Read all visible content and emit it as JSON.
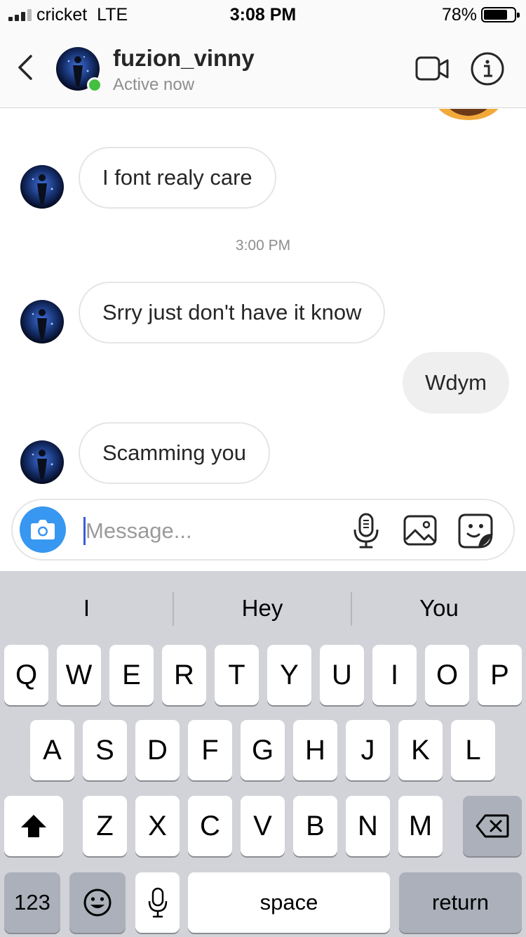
{
  "status_bar": {
    "carrier": "cricket",
    "network": "LTE",
    "time": "3:08 PM",
    "battery_pct": "78%",
    "battery_level": 0.78
  },
  "header": {
    "username": "fuzion_vinny",
    "status": "Active now",
    "icons": [
      "chevron-left-icon",
      "video-camera-icon",
      "info-icon"
    ]
  },
  "messages": [
    {
      "from": "them",
      "text": "I font realy care"
    },
    {
      "timestamp": "3:00 PM"
    },
    {
      "from": "them",
      "text": "Srry just don't have it know"
    },
    {
      "from": "me",
      "text": "Wdym"
    },
    {
      "from": "them",
      "text": "Scamming you"
    }
  ],
  "composer": {
    "placeholder": "Message...",
    "value": "",
    "icons": [
      "camera-icon",
      "microphone-icon",
      "gallery-icon",
      "sticker-icon"
    ]
  },
  "keyboard": {
    "suggestions": [
      "I",
      "Hey",
      "You"
    ],
    "row1": [
      "Q",
      "W",
      "E",
      "R",
      "T",
      "Y",
      "U",
      "I",
      "O",
      "P"
    ],
    "row2": [
      "A",
      "S",
      "D",
      "F",
      "G",
      "H",
      "J",
      "K",
      "L"
    ],
    "row3": [
      "Z",
      "X",
      "C",
      "V",
      "B",
      "N",
      "M"
    ],
    "numbers_label": "123",
    "space_label": "space",
    "return_label": "return"
  },
  "colors": {
    "accent_blue": "#3897f0",
    "online_green": "#44bf3f",
    "keyboard_bg": "#d1d3d9",
    "outgoing_bubble": "#efefef"
  }
}
